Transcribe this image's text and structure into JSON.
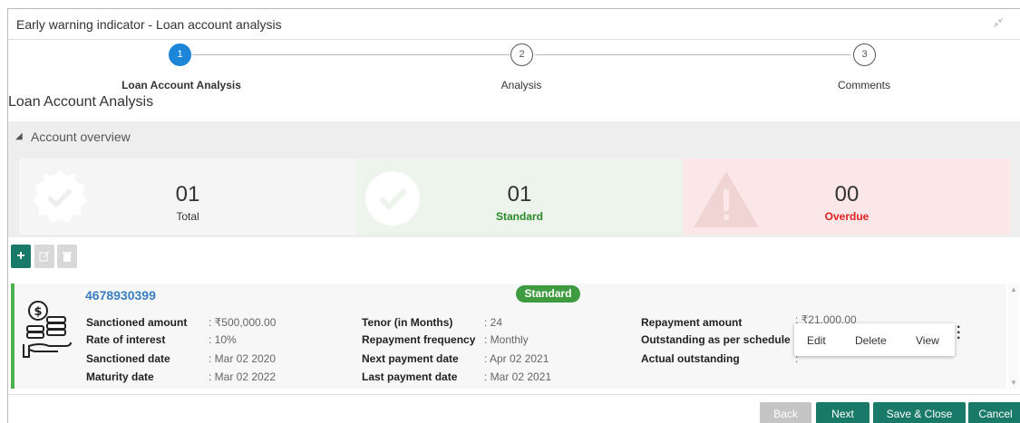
{
  "window": {
    "title": "Early warning indicator - Loan account analysis"
  },
  "stepper": {
    "steps": [
      {
        "number": "1",
        "label": "Loan Account Analysis"
      },
      {
        "number": "2",
        "label": "Analysis"
      },
      {
        "number": "3",
        "label": "Comments"
      }
    ]
  },
  "section": {
    "title": "Loan Account Analysis"
  },
  "overview": {
    "header": "Account overview",
    "total": {
      "count": "01",
      "label": "Total"
    },
    "standard": {
      "count": "01",
      "label": "Standard"
    },
    "overdue": {
      "count": "00",
      "label": "Overdue"
    }
  },
  "card": {
    "account_number": "4678930399",
    "status": "Standard",
    "col1": [
      {
        "label": "Sanctioned amount",
        "value": ": ₹500,000.00"
      },
      {
        "label": "Rate of interest",
        "value": ": 10%"
      },
      {
        "label": "Sanctioned date",
        "value": ": Mar 02 2020"
      },
      {
        "label": "Maturity date",
        "value": ": Mar 02 2022"
      }
    ],
    "col2": [
      {
        "label": "Tenor (in Months)",
        "value": ": 24"
      },
      {
        "label": "Repayment frequency",
        "value": ": Monthly"
      },
      {
        "label": "Next payment date",
        "value": ": Apr 02 2021"
      },
      {
        "label": "Last payment date",
        "value": ": Mar 02 2021"
      }
    ],
    "col3": [
      {
        "label": "Repayment amount",
        "value": ": ₹21,000.00"
      },
      {
        "label": "Outstanding as per schedule",
        "value": ""
      },
      {
        "label": "Actual outstanding",
        "value": ":"
      }
    ]
  },
  "context_menu": {
    "edit": "Edit",
    "delete": "Delete",
    "view": "View"
  },
  "footer": {
    "back": "Back",
    "next": "Next",
    "save_close": "Save & Close",
    "cancel": "Cancel"
  },
  "colors": {
    "primary": "#1a7a6a",
    "accent": "#1d86d8",
    "standard": "#3f9b3f",
    "overdue": "#e02020"
  }
}
